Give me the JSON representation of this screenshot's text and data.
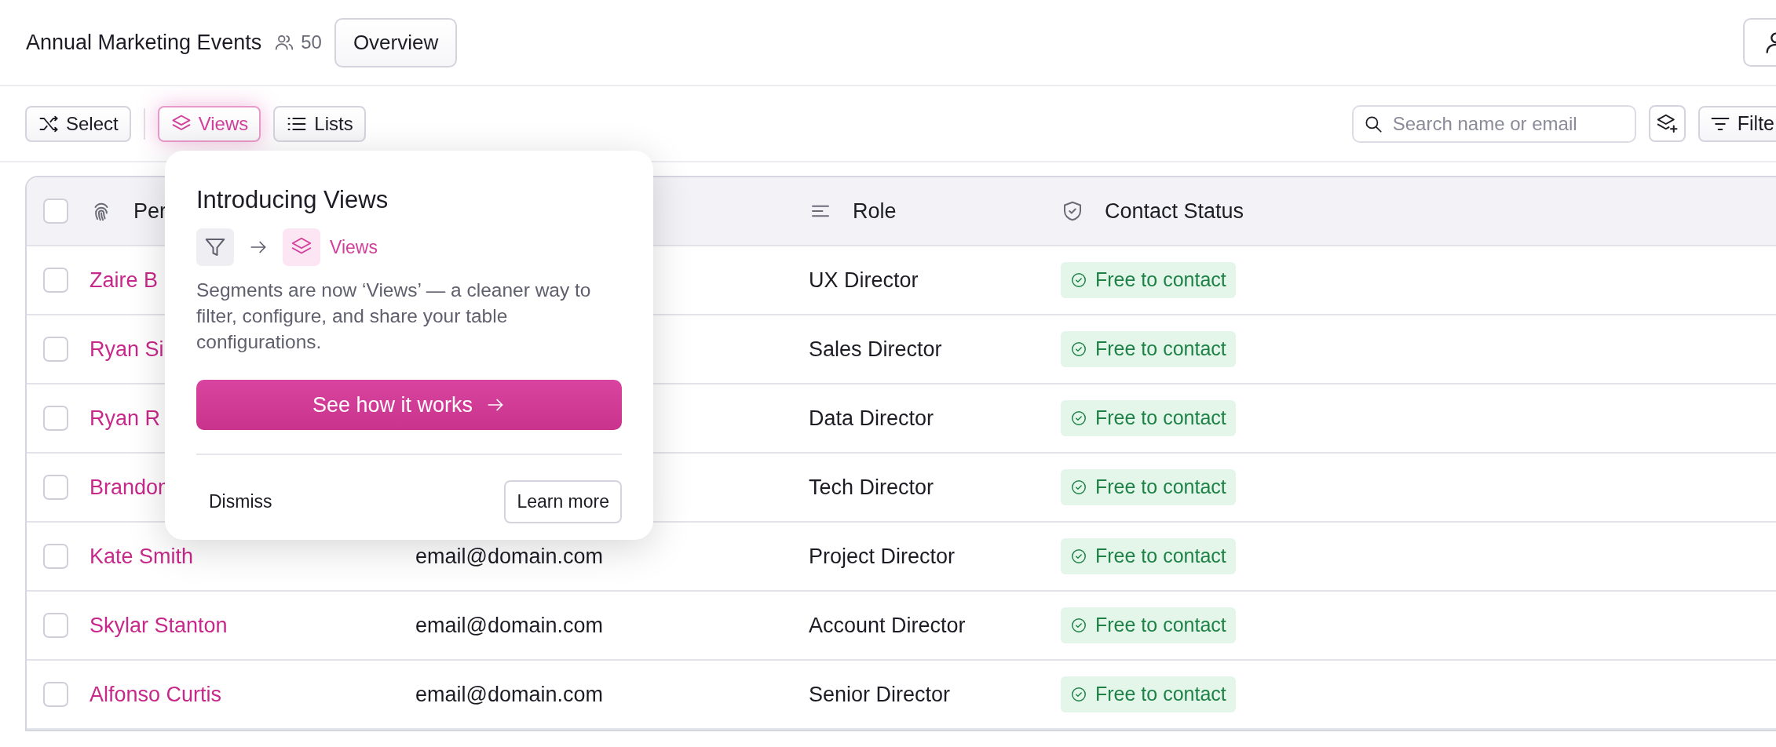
{
  "header": {
    "title": "Annual Marketing Events",
    "member_count": "50",
    "overview_button": "Overview"
  },
  "toolbar": {
    "buttons": [
      {
        "kind": "select",
        "label": "Select",
        "selected": false
      },
      {
        "kind": "views",
        "label": "Views",
        "selected": true
      },
      {
        "kind": "lists",
        "label": "Lists",
        "selected": false
      }
    ],
    "search": {
      "placeholder": "Search name or email"
    },
    "filter_button": "Filte"
  },
  "table": {
    "select_all_checked": false,
    "columns": [
      {
        "kind": "person",
        "label": "Per"
      },
      {
        "kind": "email"
      },
      {
        "kind": "role",
        "label": "Role"
      },
      {
        "kind": "status",
        "label": "Contact Status"
      }
    ],
    "rows": [
      {
        "checked": false,
        "name": "Zaire B",
        "role": "UX Director",
        "status": "Free to contact"
      },
      {
        "checked": false,
        "name": "Ryan Si",
        "role": "Sales Director",
        "status": "Free to contact"
      },
      {
        "checked": false,
        "name": "Ryan R",
        "role": "Data Director",
        "status": "Free to contact"
      },
      {
        "checked": false,
        "name": "Brandon",
        "role": "Tech Director",
        "status": "Free to contact"
      },
      {
        "checked": false,
        "name": "Kate Smith",
        "email": "email@domain.com",
        "role": "Project Director",
        "status": "Free to contact"
      },
      {
        "checked": false,
        "name": "Skylar Stanton",
        "email": "email@domain.com",
        "role": "Account Director",
        "status": "Free to contact"
      },
      {
        "checked": false,
        "name": "Alfonso Curtis",
        "email": "email@domain.com",
        "role": "Senior Director",
        "status": "Free to contact"
      }
    ]
  },
  "popover": {
    "title": "Introducing Views",
    "target_label": "Views",
    "body": "Segments are now ‘Views’ — a cleaner way to filter, configure, and share your table configurations.",
    "primary_button": "See how it works",
    "dismiss_button": "Dismiss",
    "learn_more_button": "Learn more"
  }
}
